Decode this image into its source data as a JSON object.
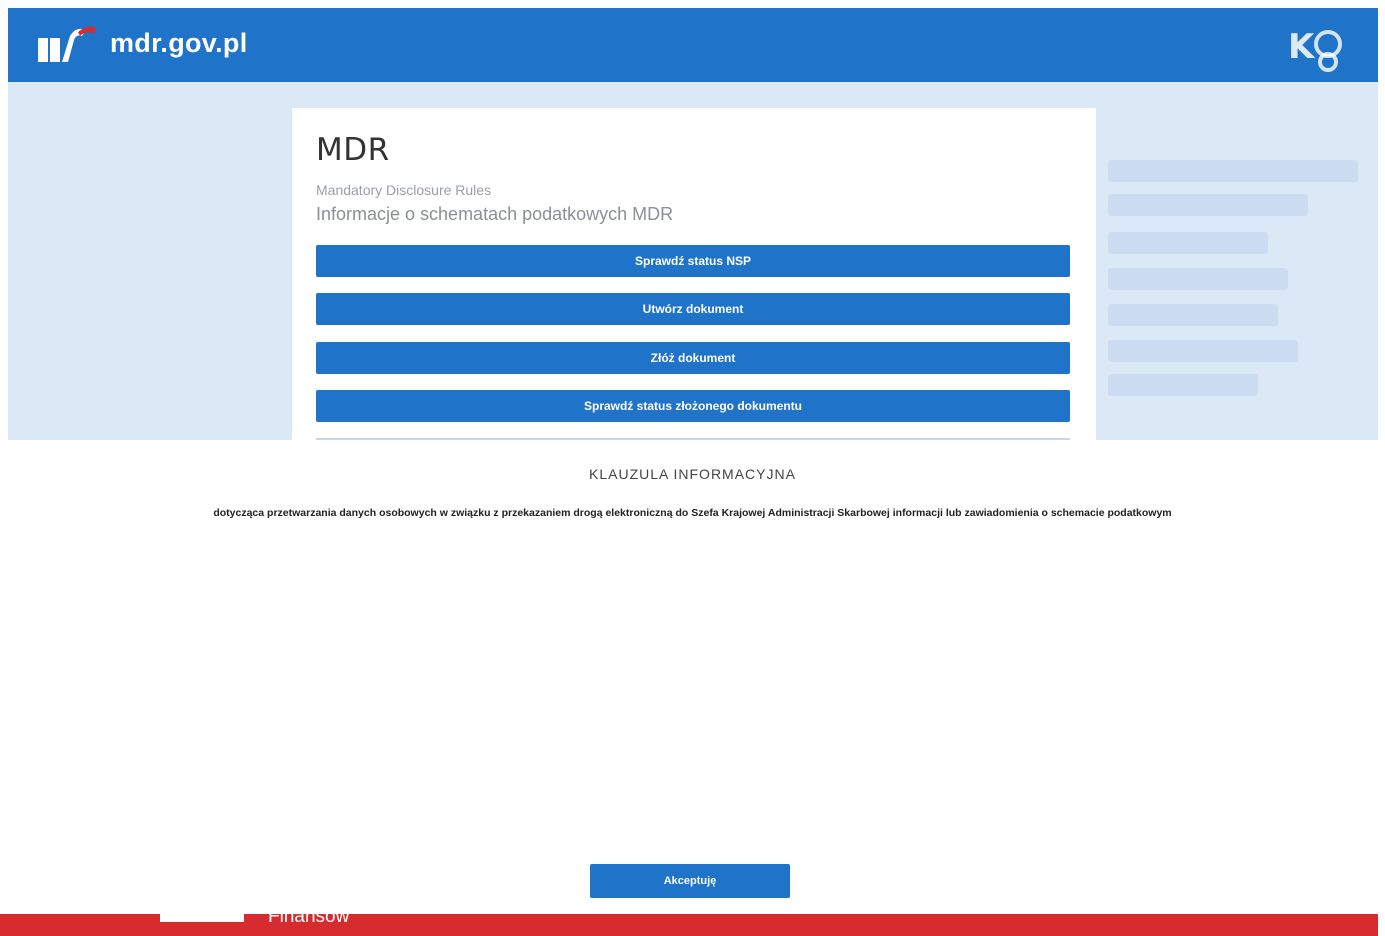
{
  "header": {
    "site_name": "mdr.gov.pl",
    "logo_icon": "mf-logo-icon",
    "kas_icon": "kas-logo-icon",
    "colors": {
      "bar": "#1f73c8",
      "footer": "#d62b2f"
    }
  },
  "card": {
    "title": "MDR",
    "subtitle": "Mandatory Disclosure Rules",
    "description": "Informacje o schematach podatkowych MDR",
    "buttons": [
      "Sprawdź status NSP",
      "Utwórz dokument",
      "Złóż dokument",
      "Sprawdź status złożonego dokumentu"
    ]
  },
  "modal": {
    "title": "KLAUZULA INFORMACYJNA",
    "subtitle": "dotycząca przetwarzania danych osobowych w związku z przekazaniem drogą elektroniczną do Szefa Krajowej Administracji Skarbowej informacji lub zawiadomienia o schemacie podatkowym",
    "intro": "",
    "items": [
      "",
      "",
      "",
      "",
      "",
      "",
      "",
      "",
      "",
      "",
      "",
      "",
      "",
      "",
      "",
      "",
      ""
    ],
    "accept_label": "Akceptuję"
  },
  "footer": {
    "text": "Finansów"
  }
}
